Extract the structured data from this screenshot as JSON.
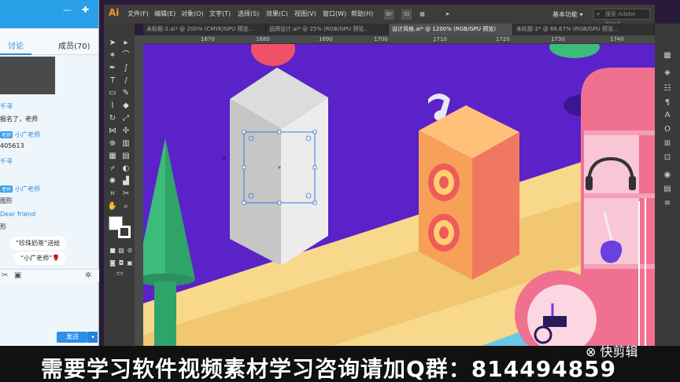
{
  "chat": {
    "pin_icon": "pin-icon",
    "tabs": [
      "讨论",
      "成员(70)"
    ],
    "messages": [
      {
        "kind": "name",
        "text": "千寻"
      },
      {
        "kind": "text",
        "text": "报名了，老师"
      },
      {
        "kind": "name",
        "tag": "老师",
        "text": "小广老师"
      },
      {
        "kind": "text",
        "text": "405613"
      },
      {
        "kind": "name",
        "text": "千寻"
      },
      {
        "kind": "name",
        "tag": "老师",
        "text": "小广老师"
      },
      {
        "kind": "text",
        "text": "图形"
      },
      {
        "kind": "name",
        "text": "Dear friend"
      },
      {
        "kind": "text",
        "text": "形"
      }
    ],
    "bubbles": [
      "“珍珠奶茶”送给",
      "“小广老师”🌹"
    ],
    "send_label": "发送"
  },
  "illustrator": {
    "logo": "Ai",
    "menu": [
      "文件(F)",
      "编辑(E)",
      "对象(O)",
      "文字(T)",
      "选择(S)",
      "效果(C)",
      "视图(V)",
      "窗口(W)",
      "帮助(H)"
    ],
    "bridge": "Br",
    "stock": "St",
    "workspace": "基本功能 ▾",
    "search_placeholder": "搜索 Adobe Stock",
    "tabs": [
      "未标题-2.ai* @ 200% (CMYK/GPU 预览...",
      "品牌设计.ai* @ 25% (RGB/GPU 预览...",
      "设计风格.ai* @ 1200% (RGB/GPU 预览)",
      "未标题-2* @ 66.67% (RGB/GPU 预览..."
    ],
    "active_tab_index": 2,
    "ruler": [
      "1670",
      "1680",
      "1690",
      "1700",
      "1710",
      "1720",
      "1730",
      "1740"
    ]
  },
  "overlay": {
    "ad_text": "需要学习软件视频素材学习咨询请加Q群：814494859",
    "watermark": "快剪辑"
  },
  "colors": {
    "canvas_bg": "#5a22c8",
    "path_yellow": "#f8d88a",
    "tree_green": "#3dbb7a",
    "speaker_orange": "#f7a057",
    "shelf_pink": "#f07090",
    "selection": "#3a7bd5"
  }
}
